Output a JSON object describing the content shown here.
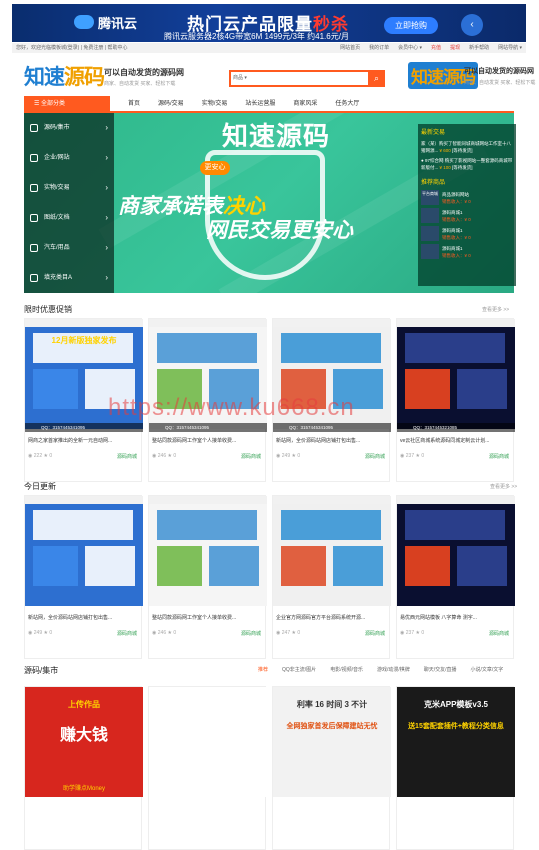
{
  "ad": {
    "logo": "腾讯云",
    "headline_a": "热门云产品限量",
    "headline_b": "秒杀",
    "subline": "腾讯云服务器2核4G带宽6M 1499元/3年 约41.6元/月",
    "button": "立即抢购",
    "arrow": "‹"
  },
  "topbar": {
    "left": "您好，欢迎光临模板城(登录) | 免费注册 | 帮助中心",
    "links": [
      {
        "text": "网站首页",
        "red": false
      },
      {
        "text": "我的订单",
        "red": false
      },
      {
        "text": "会员中心 ▾",
        "red": false
      },
      {
        "text": "充值",
        "red": true
      },
      {
        "text": "提现",
        "red": true
      },
      {
        "text": "新手帮助",
        "red": false
      },
      {
        "text": "网站导航 ▾",
        "red": false
      }
    ]
  },
  "header": {
    "logo_a": "知速",
    "logo_b": "源码",
    "slogan": "可以自动发货的源码网",
    "slogan_sub": "商家、自动发货   买家、轻松下载",
    "search_select": "商品 ▾",
    "search_button": "⌕",
    "logo2": "知速源码",
    "logo2_text": "可以自动发货的源码网",
    "logo2_sub": "商家、自动发货   买家、轻松下载"
  },
  "nav": {
    "category": "☰ 全部分类",
    "links": [
      "首页",
      "源码/交易",
      "实物/交易",
      "站长运营服",
      "商家风采",
      "任务大厅"
    ]
  },
  "side_menu": [
    {
      "label": "源码/集市"
    },
    {
      "label": "企业/网站"
    },
    {
      "label": "实物/交易"
    },
    {
      "label": "图纸/文档"
    },
    {
      "label": "汽车/用品"
    },
    {
      "label": "填充类目A"
    }
  ],
  "hero": {
    "title": "知速源码",
    "badge": "更安心",
    "line1_a": "商家承诺表",
    "line1_b": "决心",
    "line2": "网民交易更安心"
  },
  "news": {
    "title": "最新交易",
    "items": [
      {
        "text": "家（某）购买了智能同城商城网站工作室十八猪网源...",
        "price": "¥ 600",
        "status": "[等待发货]"
      },
      {
        "text": "● 97综合网 购买了影视网站一整套源码商城带新版付...",
        "price": "¥ 100",
        "status": "[等待发货]"
      }
    ],
    "recommend_title": "推荐商品",
    "products": [
      {
        "thumb": "平台商城",
        "name": "商品源码网站",
        "sales": "销售收入：¥ 0"
      },
      {
        "thumb": "",
        "name": "源码商城1",
        "sales": "销售收入：¥ 0"
      },
      {
        "thumb": "",
        "name": "源码商城1",
        "sales": "销售收入：¥ 0"
      },
      {
        "thumb": "",
        "name": "源码商城1",
        "sales": "销售收入：¥ 0"
      }
    ]
  },
  "section1": {
    "title": "限时优惠促销",
    "more": "查看更多 >>",
    "cards": [
      {
        "banner": "12月新版独家发布",
        "id_text": "QQ：3157445341095",
        "caption": "网商之家首家推出的全新一元自动网...",
        "views": "222",
        "stars": "0",
        "store": "源码商城"
      },
      {
        "banner": "",
        "id_text": "QQ：3157445341095",
        "caption": "整站同款源码网工作室个人接单收费...",
        "views": "246",
        "stars": "0",
        "store": "源码商城"
      },
      {
        "banner": "",
        "id_text": "QQ：3157445341095",
        "caption": "新站网，全价源码站网店铺打包出售...",
        "views": "249",
        "stars": "0",
        "store": "源码商城"
      },
      {
        "banner": "",
        "id_text": "QQ：3157445321085",
        "caption": "ve云社区商城系统源码同城定制云计划...",
        "views": "237",
        "stars": "0",
        "store": "源码商城"
      }
    ]
  },
  "watermark": "https://www.ku668.cn",
  "section2": {
    "title": "今日更新",
    "more": "查看更多 >>",
    "cards": [
      {
        "caption": "新站网，全价源码站网店铺打包出售...",
        "views": "249",
        "stars": "0",
        "store": "源码商城"
      },
      {
        "caption": "整站同款源码网工作室个人接单收费...",
        "views": "246",
        "stars": "0",
        "store": "源码商城"
      },
      {
        "caption": "企业官方网源码官方平台源码系统开源...",
        "views": "247",
        "stars": "0",
        "store": "源码商城"
      },
      {
        "caption": "易优西元网站模板 八字算命 测字...",
        "views": "237",
        "stars": "0",
        "store": "源码商城"
      }
    ]
  },
  "section3": {
    "title": "源码/集市",
    "tabs": [
      "推荐",
      "QQ非主流/图片",
      "电影/视频/音乐",
      "游戏/动漫/棋牌",
      "聊天/交友/直播",
      "小说/文章/文字"
    ],
    "cards": [
      {
        "line1": "上传作品",
        "line2": "赚大钱",
        "line3": "助学赚点Money"
      },
      {
        "line1": "",
        "line2": "",
        "line3": ""
      },
      {
        "line1": "利率 16 时间 3 不计",
        "line2": "全网独家首发后保障建站无忧",
        "line3": ""
      },
      {
        "line1": "克米APP模板v3.5",
        "line2": "送15套配套插件+教程分类信息",
        "line3": ""
      }
    ]
  }
}
